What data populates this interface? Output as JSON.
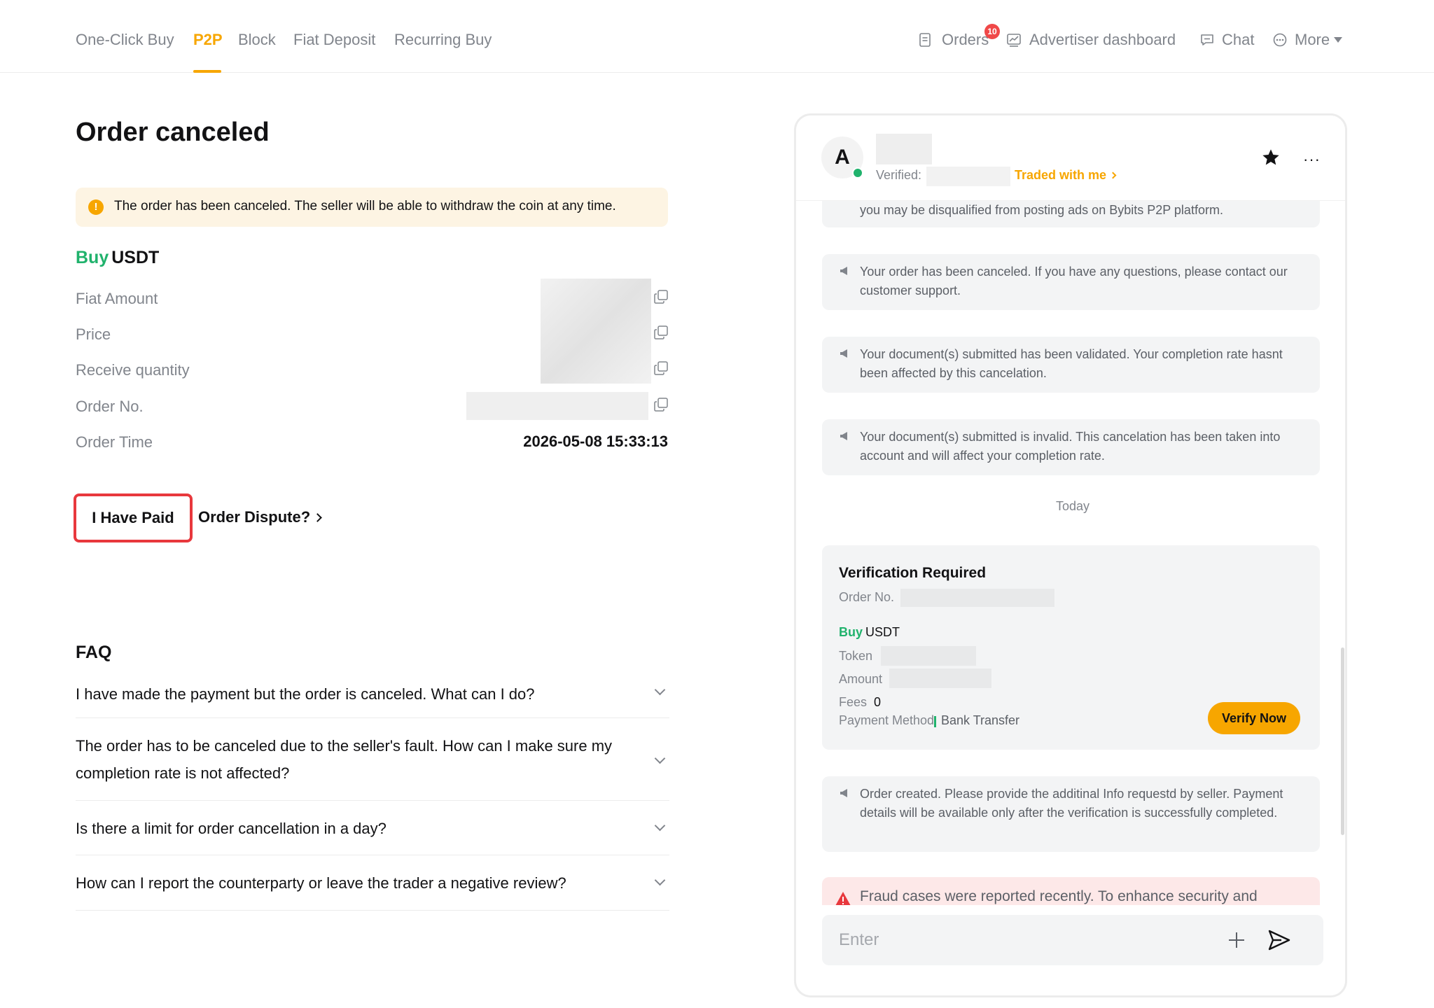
{
  "nav": {
    "tabs": [
      {
        "label": "One-Click Buy"
      },
      {
        "label": "P2P"
      },
      {
        "label": "Block"
      },
      {
        "label": "Fiat Deposit"
      },
      {
        "label": "Recurring Buy"
      }
    ],
    "active_tab": "P2P",
    "orders_label": "Orders",
    "orders_badge": "10",
    "advertiser_label": "Advertiser dashboard",
    "chat_label": "Chat",
    "more_label": "More"
  },
  "order": {
    "title": "Order canceled",
    "alert": "The order has been canceled. The seller will be able to withdraw the coin at any time.",
    "side": "Buy",
    "asset": "USDT",
    "rows": {
      "fiat_amount": "Fiat Amount",
      "price": "Price",
      "receive_quantity": "Receive quantity",
      "order_no": "Order No.",
      "order_time": "Order Time"
    },
    "order_time_value": "2026-05-08 15:33:13",
    "paid_button": "I Have Paid",
    "dispute_link": "Order Dispute?"
  },
  "faq": {
    "title": "FAQ",
    "items": [
      "I have made the payment but the order is canceled. What can I do?",
      "The order has to be canceled due to the seller's fault. How can I make sure my completion rate is not affected?",
      "Is there a limit for order cancellation in a day?",
      "How can I report the counterparty or leave the trader a negative review?"
    ]
  },
  "chat": {
    "avatar_letter": "A",
    "verified_label": "Verified:",
    "traded_label": "Traded with me",
    "messages": [
      "you may be disqualified from posting ads on Bybits P2P platform.",
      "Your order has been canceled. If you have any questions, please contact our customer support.",
      "Your document(s) submitted has been validated. Your completion rate hasnt been affected by this cancelation.",
      "Your document(s) submitted is invalid. This cancelation has been taken into account and will affect your completion rate.",
      "Order created. Please provide the additinal Info requestd by seller. Payment details will be available only after the verification is successfully completed."
    ],
    "today": "Today",
    "verify_card": {
      "title": "Verification Required",
      "order_no_label": "Order No.",
      "side": "Buy",
      "asset": "USDT",
      "token_label": "Token",
      "amount_label": "Amount",
      "fees_label": "Fees",
      "fees_value": "0",
      "payment_label": "Payment Method",
      "payment_value": "Bank Transfer",
      "button": "Verify Now"
    },
    "fraud": "Fraud cases were reported recently. To enhance security and",
    "input_placeholder": "Enter"
  },
  "colors": {
    "accent": "#f7a600",
    "buy": "#20b26c",
    "highlight": "#e8383d",
    "badge": "#f04848"
  }
}
